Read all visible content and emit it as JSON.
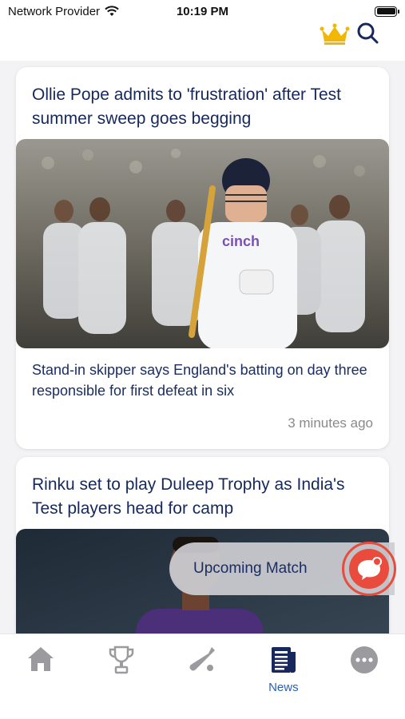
{
  "status_bar": {
    "carrier": "Network Provider",
    "time": "10:19 PM"
  },
  "header": {
    "icons": [
      "crown-icon",
      "search-icon"
    ],
    "crown_color": "#f2b705",
    "brand_color": "#16285c"
  },
  "articles": [
    {
      "title": "Ollie Pope admits to 'frustration' after Test summer sweep goes begging",
      "summary": "Stand-in skipper says England's batting on day three responsible for first defeat in six",
      "time": "3 minutes ago"
    },
    {
      "title": "Rinku set to play Duleep Trophy as India's Test players head for camp"
    }
  ],
  "floating": {
    "label": "Upcoming Match",
    "accent": "#e94b3c"
  },
  "tabs": [
    {
      "icon": "home-icon",
      "label": ""
    },
    {
      "icon": "trophy-icon",
      "label": ""
    },
    {
      "icon": "cricket-bat-icon",
      "label": ""
    },
    {
      "icon": "news-icon",
      "label": "News",
      "active": true
    },
    {
      "icon": "more-icon",
      "label": ""
    }
  ]
}
